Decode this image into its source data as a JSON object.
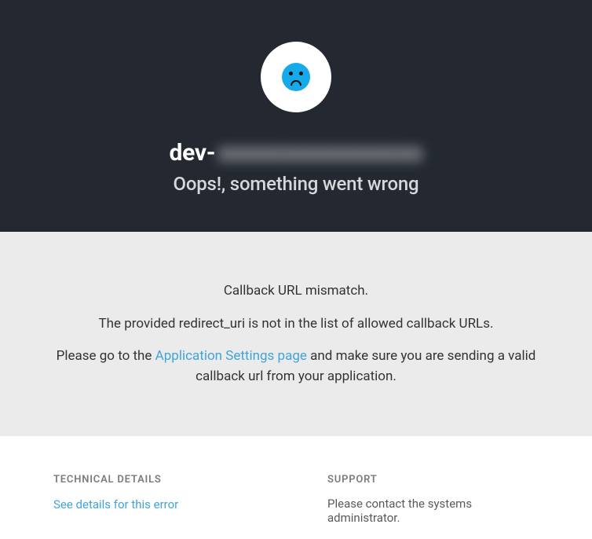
{
  "header": {
    "tenant_prefix": "dev-",
    "tenant_blurred": "xxxxxxxxxxxxxxxx",
    "subtitle": "Oops!, something went wrong"
  },
  "message": {
    "line1": "Callback URL mismatch.",
    "line2": "The provided redirect_uri is not in the list of allowed callback URLs.",
    "line3_before": "Please go to the ",
    "settings_link_text": "Application Settings page",
    "line3_after": " and make sure you are sending a valid callback url from your application."
  },
  "footer": {
    "technical": {
      "heading": "TECHNICAL DETAILS",
      "link_text": "See details for this error"
    },
    "support": {
      "heading": "SUPPORT",
      "text": "Please contact the systems administrator."
    }
  }
}
